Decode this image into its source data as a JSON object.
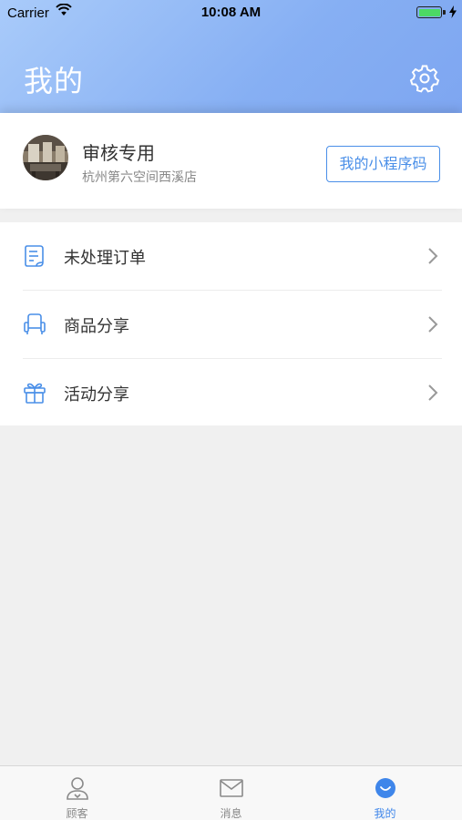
{
  "status_bar": {
    "carrier": "Carrier",
    "time": "10:08 AM",
    "battery_level": 1.0
  },
  "header": {
    "title": "我的",
    "settings_icon": "gear-icon"
  },
  "profile": {
    "name": "审核专用",
    "store": "杭州第六空间西溪店",
    "qr_button": "我的小程序码"
  },
  "menu": {
    "items": [
      {
        "label": "未处理订单",
        "icon": "order-list-icon"
      },
      {
        "label": "商品分享",
        "icon": "sofa-icon"
      },
      {
        "label": "活动分享",
        "icon": "gift-icon"
      }
    ]
  },
  "tabbar": {
    "tabs": [
      {
        "label": "顾客",
        "icon": "user-icon",
        "active": false
      },
      {
        "label": "消息",
        "icon": "mail-icon",
        "active": false
      },
      {
        "label": "我的",
        "icon": "smile-icon",
        "active": true
      }
    ]
  },
  "colors": {
    "accent": "#3f86ea",
    "header_start": "#a9cbfa",
    "header_end": "#7ea6f1",
    "background": "#f0f0f0"
  }
}
